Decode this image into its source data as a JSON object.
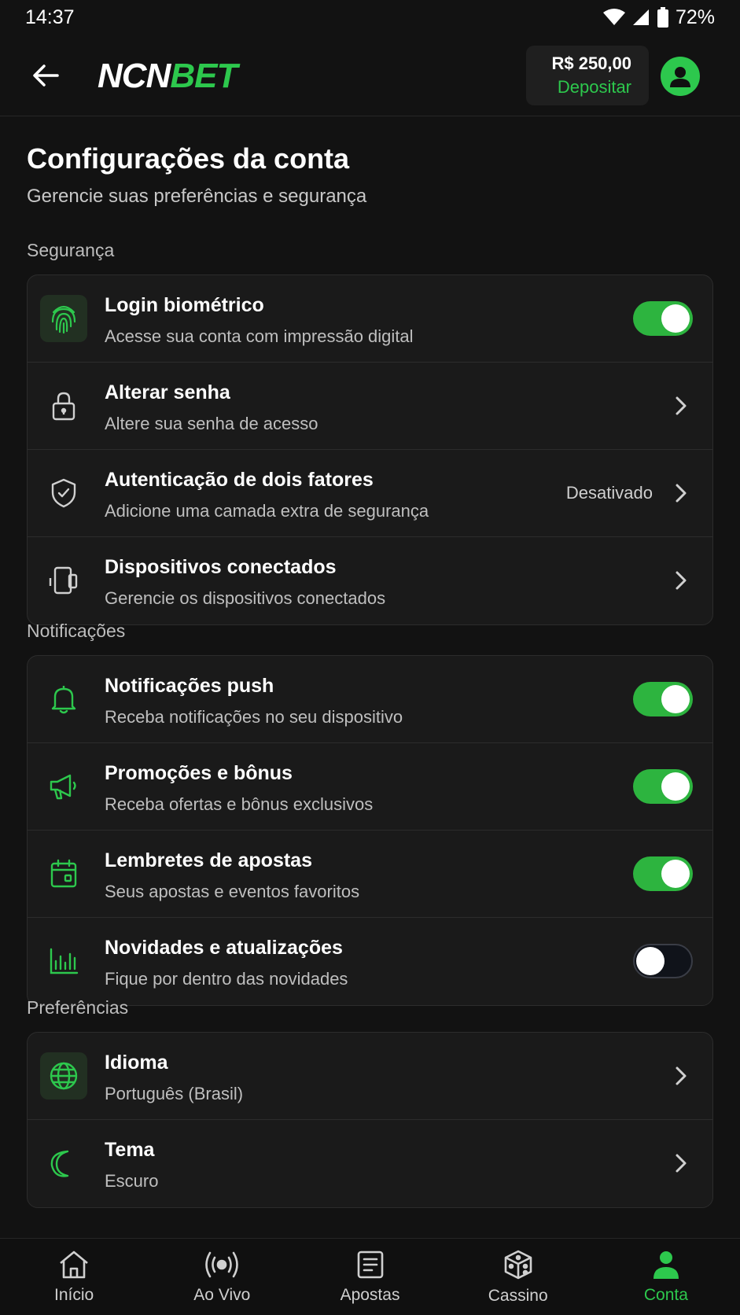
{
  "status_bar": {
    "time": "14:37",
    "battery": "72%"
  },
  "header": {
    "logo_part1": "NCN",
    "logo_part2": "BET",
    "balance": "R$ 250,00",
    "deposit_label": "Depositar"
  },
  "page": {
    "title": "Configurações da conta",
    "subtitle": "Gerencie suas preferências e segurança"
  },
  "sections": {
    "security": {
      "label": "Segurança",
      "items": [
        {
          "title": "Login biométrico",
          "subtitle": "Acesse sua conta com impressão digital",
          "icon": "fingerprint-icon",
          "toggle_on": true
        },
        {
          "title": "Alterar senha",
          "subtitle": "Altere sua senha de acesso",
          "icon": "lock-icon"
        },
        {
          "title": "Autenticação de dois fatores",
          "subtitle": "Adicione uma camada extra de segurança",
          "icon": "shield-icon",
          "value": "Desativado"
        },
        {
          "title": "Dispositivos conectados",
          "subtitle": "Gerencie os dispositivos conectados",
          "icon": "devices-icon"
        }
      ]
    },
    "notifications": {
      "label": "Notificações",
      "items": [
        {
          "title": "Notificações push",
          "subtitle": "Receba notificações no seu dispositivo",
          "icon": "bell-icon",
          "toggle_on": true
        },
        {
          "title": "Promoções e bônus",
          "subtitle": "Receba ofertas e bônus exclusivos",
          "icon": "megaphone-icon",
          "toggle_on": true
        },
        {
          "title": "Lembretes de apostas",
          "subtitle": "Seus apostas e eventos favoritos",
          "icon": "calendar-icon",
          "toggle_on": true
        },
        {
          "title": "Novidades e atualizações",
          "subtitle": "Fique por dentro das novidades",
          "icon": "chart-icon",
          "toggle_on": false
        }
      ]
    },
    "preferences": {
      "label": "Preferências",
      "items": [
        {
          "title": "Idioma",
          "subtitle": "Português (Brasil)",
          "icon": "globe-icon"
        },
        {
          "title": "Tema",
          "subtitle": "Escuro",
          "icon": "moon-icon"
        }
      ]
    }
  },
  "bottom_nav": [
    {
      "label": "Início",
      "icon": "home-icon"
    },
    {
      "label": "Ao Vivo",
      "icon": "live-icon"
    },
    {
      "label": "Apostas",
      "icon": "bets-icon"
    },
    {
      "label": "Cassino",
      "icon": "dice-icon"
    },
    {
      "label": "Conta",
      "icon": "account-icon",
      "active": true
    }
  ],
  "colors": {
    "accent": "#2dc84d",
    "background": "#121212",
    "card": "#1a1a1a"
  }
}
